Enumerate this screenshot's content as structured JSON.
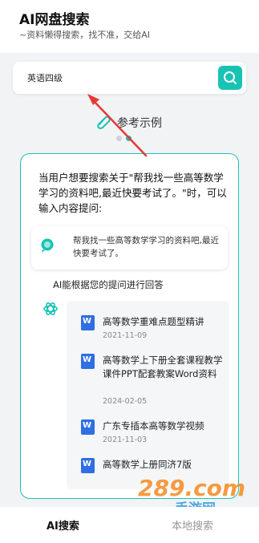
{
  "header": {
    "title": "AI网盘搜索",
    "subtitle": "~资料懒得搜索，找不准，交给AI"
  },
  "search": {
    "value": "英语四级"
  },
  "examples": {
    "label": "参考示例"
  },
  "card": {
    "intro": "当用户想要搜索关于\"帮我找一些高等数学学习的资料吧,最近快要考试了。\"时，可以输入内容提问:",
    "prompt": "帮我找一些高等数学学习的资料吧,最近快要考试了。",
    "answer_heading": "AI能根据您的提问进行回答",
    "results": [
      {
        "title": "高等数学重难点题型精讲",
        "date": "2021-11-09"
      },
      {
        "title": "高等数学上下册全套课程教学课件PPT配套教案Word资料",
        "date": "2024-02-05"
      },
      {
        "title": "广东专插本高等数学视频",
        "date": "2021-11-03"
      },
      {
        "title": "高等数学上册同济7版",
        "date": ""
      }
    ]
  },
  "watermark": {
    "brand": "289.com",
    "site": "手游网"
  },
  "tabs": {
    "ai": "AI搜索",
    "local": "本地搜索"
  },
  "colors": {
    "accent": "#19c3b4",
    "word_blue": "#2f6ee3",
    "arrow_red": "#e53935"
  }
}
